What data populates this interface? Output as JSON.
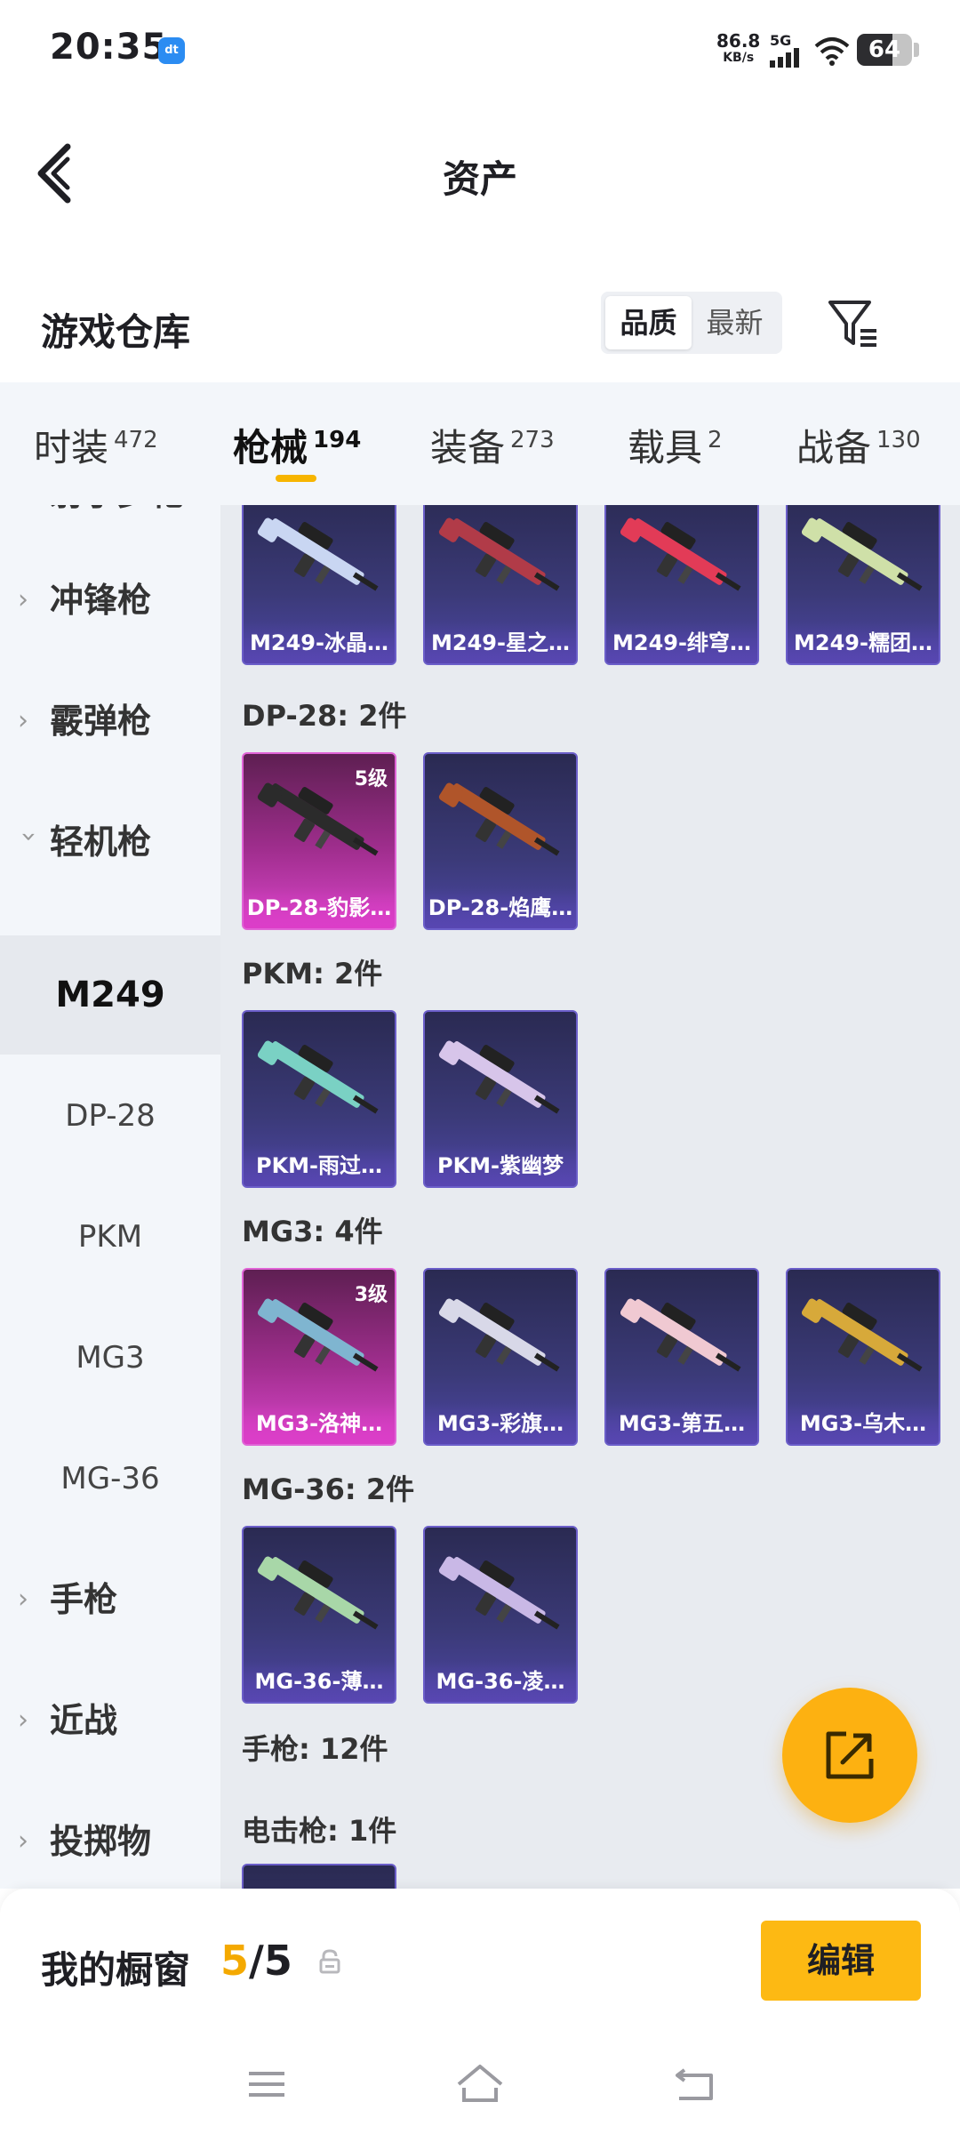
{
  "status": {
    "time": "20:35",
    "app_icon_text": "dt",
    "net_speed": "86.8",
    "net_unit": "KB/s",
    "network": "5G",
    "battery": "64",
    "battery_level": 0.64
  },
  "header": {
    "title": "资产",
    "back_icon": "chevron-left-icon"
  },
  "section": {
    "title": "游戏仓库",
    "sort_options": [
      "品质",
      "最新"
    ],
    "sort_selected": "品质",
    "filter_icon": "filter-icon"
  },
  "tabs": [
    {
      "label": "时装",
      "count": "472"
    },
    {
      "label": "枪械",
      "count": "194",
      "active": true
    },
    {
      "label": "装备",
      "count": "273"
    },
    {
      "label": "载具",
      "count": "2"
    },
    {
      "label": "战备",
      "count": "130"
    }
  ],
  "sidebar": {
    "categories": [
      {
        "label": "射手步枪"
      },
      {
        "label": "冲锋枪"
      },
      {
        "label": "霰弹枪"
      },
      {
        "label": "轻机枪",
        "expanded": true
      },
      {
        "label": "手枪"
      },
      {
        "label": "近战"
      },
      {
        "label": "投掷物"
      }
    ],
    "subitems": [
      {
        "label": "M249",
        "active": true
      },
      {
        "label": "DP-28"
      },
      {
        "label": "PKM"
      },
      {
        "label": "MG3"
      },
      {
        "label": "MG-36"
      }
    ]
  },
  "content": {
    "top_row": [
      {
        "name": "M249-冰晶…",
        "accent": "#c9d6f2"
      },
      {
        "name": "M249-星之…",
        "accent": "#b13b48"
      },
      {
        "name": "M249-绯穹…",
        "accent": "#e23b57"
      },
      {
        "name": "M249-糯团…",
        "accent": "#cfe0a8"
      }
    ],
    "groups": [
      {
        "label": "DP-28: 2件",
        "items": [
          {
            "name": "DP-28-豹影…",
            "level": "5级",
            "rarity": "pink",
            "accent": "#2b2b2b"
          },
          {
            "name": "DP-28-焰鹰…",
            "accent": "#b0552a"
          }
        ]
      },
      {
        "label": "PKM: 2件",
        "items": [
          {
            "name": "PKM-雨过…",
            "accent": "#7ad1c4"
          },
          {
            "name": "PKM-紫幽梦",
            "accent": "#d7c5ea"
          }
        ]
      },
      {
        "label": "MG3: 4件",
        "items": [
          {
            "name": "MG3-洛神…",
            "level": "3级",
            "rarity": "pink",
            "accent": "#7fb5d0"
          },
          {
            "name": "MG3-彩旗…",
            "accent": "#d8d8e8"
          },
          {
            "name": "MG3-第五…",
            "accent": "#f0c9d2"
          },
          {
            "name": "MG3-乌木…",
            "accent": "#d7a93a"
          }
        ]
      },
      {
        "label": "MG-36: 2件",
        "items": [
          {
            "name": "MG-36-薄…",
            "accent": "#a8d7a8"
          },
          {
            "name": "MG-36-凌…",
            "accent": "#c9b8e6"
          }
        ]
      }
    ],
    "pistol_label": "手枪: 12件",
    "stun_label": "电击枪: 1件"
  },
  "fab": {
    "icon": "share-icon"
  },
  "showcase": {
    "label": "我的橱窗",
    "current": "5",
    "separator": "/5",
    "lock_icon": "lock-icon",
    "edit_label": "编辑"
  },
  "nav": {
    "menu_icon": "menu-icon",
    "home_icon": "home-icon",
    "back_icon": "back-icon"
  },
  "colors": {
    "accent": "#fdb913",
    "tab_underline": "#f7b500",
    "card_purple": "#3b3a78",
    "card_pink": "#a02e8e"
  }
}
